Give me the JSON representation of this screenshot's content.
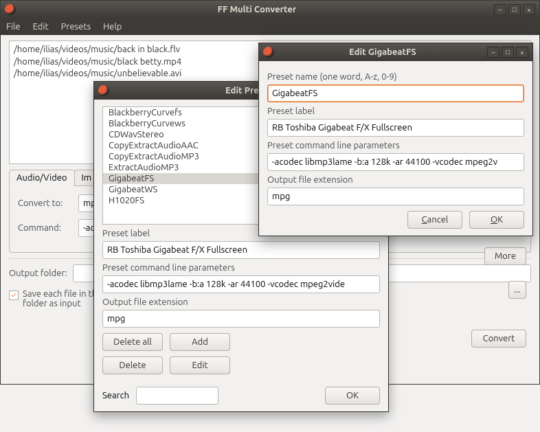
{
  "main": {
    "title": "FF Multi Converter",
    "menus": [
      "File",
      "Edit",
      "Presets",
      "Help"
    ],
    "files": [
      "/home/ilias/videos/music/back in black.flv",
      "/home/ilias/videos/music/black betty.mp4",
      "/home/ilias/videos/music/unbelievable.avi"
    ],
    "tabs": {
      "audio_video": "Audio/Video",
      "images": "Im"
    },
    "convert_to": "Convert to:",
    "convert_val": "mp",
    "command": "Command:",
    "command_val": "-ac",
    "output_folder": "Output folder:",
    "save_same": "Save each file in the\nfolder as input",
    "more": "More",
    "ellipsis": "...",
    "convert": "Convert"
  },
  "preset_list_dialog": {
    "title": "Edit Preset",
    "items": [
      "BlackberryCurvefs",
      "BlackberryCurvews",
      "CDWavStereo",
      "CopyExtractAudioAAC",
      "CopyExtractAudioMP3",
      "ExtractAudioMP3",
      "GigabeatFS",
      "GigabeatWS",
      "H1020FS"
    ],
    "preset_label_lbl": "Preset label",
    "preset_label_val": "RB Toshiba Gigabeat F/X Fullscreen",
    "cmd_lbl": "Preset command line parameters",
    "cmd_val": "-acodec libmp3lame -b:a 128k -ar 44100 -vcodec mpeg2vide",
    "ext_lbl": "Output file extension",
    "ext_val": "mpg",
    "delete_all": "Delete all",
    "add": "Add",
    "delete": "Delete",
    "edit": "Edit",
    "search": "Search",
    "ok": "OK"
  },
  "edit_dialog": {
    "title": "Edit GigabeatFS",
    "name_lbl": "Preset name (one word, A-z, 0-9)",
    "name_val": "GigabeatFS",
    "label_lbl": "Preset label",
    "label_val": "RB Toshiba Gigabeat F/X Fullscreen",
    "cmd_lbl": "Preset command line parameters",
    "cmd_val": "-acodec libmp3lame -b:a 128k -ar 44100 -vcodec mpeg2v",
    "ext_lbl": "Output file extension",
    "ext_val": "mpg",
    "cancel": "Cancel",
    "ok": "OK"
  }
}
